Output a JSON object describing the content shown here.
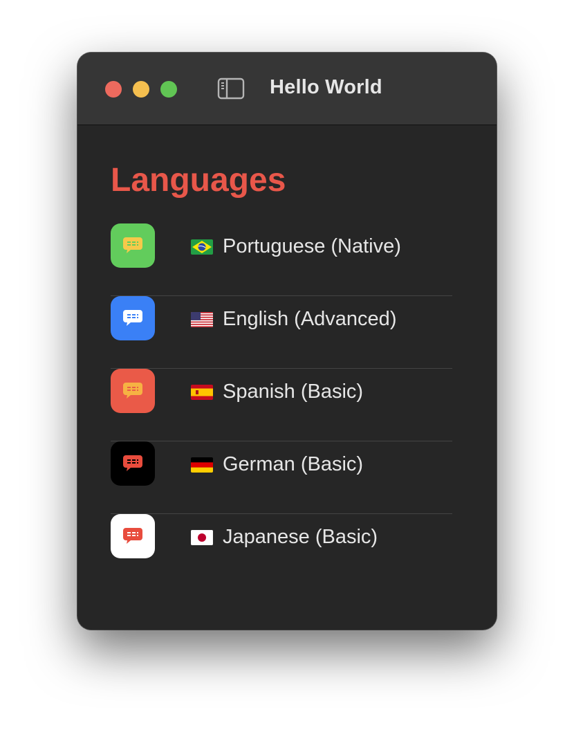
{
  "window": {
    "title": "Hello World"
  },
  "header": {
    "title": "Languages",
    "title_color": "#e8574a"
  },
  "languages": [
    {
      "label": "Portuguese (Native)",
      "flag": "flag-brazil-icon",
      "icon_bg": "#62cc5c",
      "bubble": "#f6c94a"
    },
    {
      "label": "English (Advanced)",
      "flag": "flag-usa-icon",
      "icon_bg": "#3a80f6",
      "bubble": "#ffffff"
    },
    {
      "label": "Spanish (Basic)",
      "flag": "flag-spain-icon",
      "icon_bg": "#ea5a48",
      "bubble": "#f6b243"
    },
    {
      "label": "German (Basic)",
      "flag": "flag-germany-icon",
      "icon_bg": "#000000",
      "bubble": "#e84c3d"
    },
    {
      "label": "Japanese (Basic)",
      "flag": "flag-japan-icon",
      "icon_bg": "#ffffff",
      "bubble": "#e84c3d"
    }
  ]
}
